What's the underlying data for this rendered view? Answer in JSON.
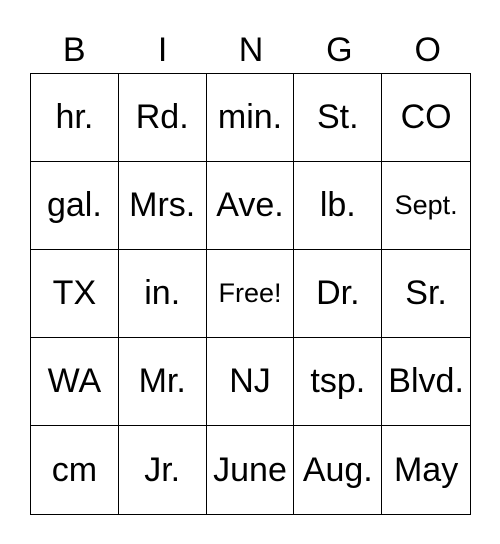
{
  "header": [
    "B",
    "I",
    "N",
    "G",
    "O"
  ],
  "cells": [
    [
      "hr.",
      "Rd.",
      "min.",
      "St.",
      "CO"
    ],
    [
      "gal.",
      "Mrs.",
      "Ave.",
      "lb.",
      "Sept."
    ],
    [
      "TX",
      "in.",
      "Free!",
      "Dr.",
      "Sr."
    ],
    [
      "WA",
      "Mr.",
      "NJ",
      "tsp.",
      "Blvd."
    ],
    [
      "cm",
      "Jr.",
      "June",
      "Aug.",
      "May"
    ]
  ]
}
